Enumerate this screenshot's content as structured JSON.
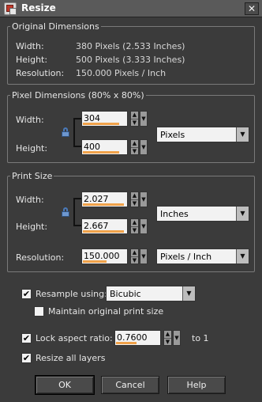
{
  "window": {
    "title": "Resize",
    "close_glyph": "✕"
  },
  "original": {
    "legend": "Original Dimensions",
    "rows": [
      {
        "label": "Width:",
        "value": "380 Pixels (2.533 Inches)"
      },
      {
        "label": "Height:",
        "value": "500 Pixels (3.333 Inches)"
      },
      {
        "label": "Resolution:",
        "value": "150.000 Pixels / Inch"
      }
    ]
  },
  "pixel": {
    "legend": "Pixel Dimensions (80% x 80%)",
    "width_label": "Width:",
    "width_value": "304",
    "height_label": "Height:",
    "height_value": "400",
    "unit": "Pixels"
  },
  "print": {
    "legend": "Print Size",
    "width_label": "Width:",
    "width_value": "2.027",
    "height_label": "Height:",
    "height_value": "2.667",
    "unit": "Inches",
    "resolution_label": "Resolution:",
    "resolution_value": "150.000",
    "resolution_unit": "Pixels / Inch"
  },
  "options": {
    "resample_label": "Resample using:",
    "resample_checked": true,
    "resample_method": "Bicubic",
    "maintain_label": "Maintain original print size",
    "maintain_checked": false,
    "lock_label": "Lock aspect ratio:",
    "lock_checked": true,
    "lock_value": "0.7600",
    "lock_suffix": "to 1",
    "resize_all_label": "Resize all layers",
    "resize_all_checked": true,
    "check_glyph": "✔"
  },
  "buttons": {
    "ok": "OK",
    "cancel": "Cancel",
    "help": "Help"
  },
  "icons": {
    "lock": "lock-icon",
    "spin_up": "▲",
    "spin_down": "▼",
    "step": "▼",
    "dropdown": "▼"
  }
}
